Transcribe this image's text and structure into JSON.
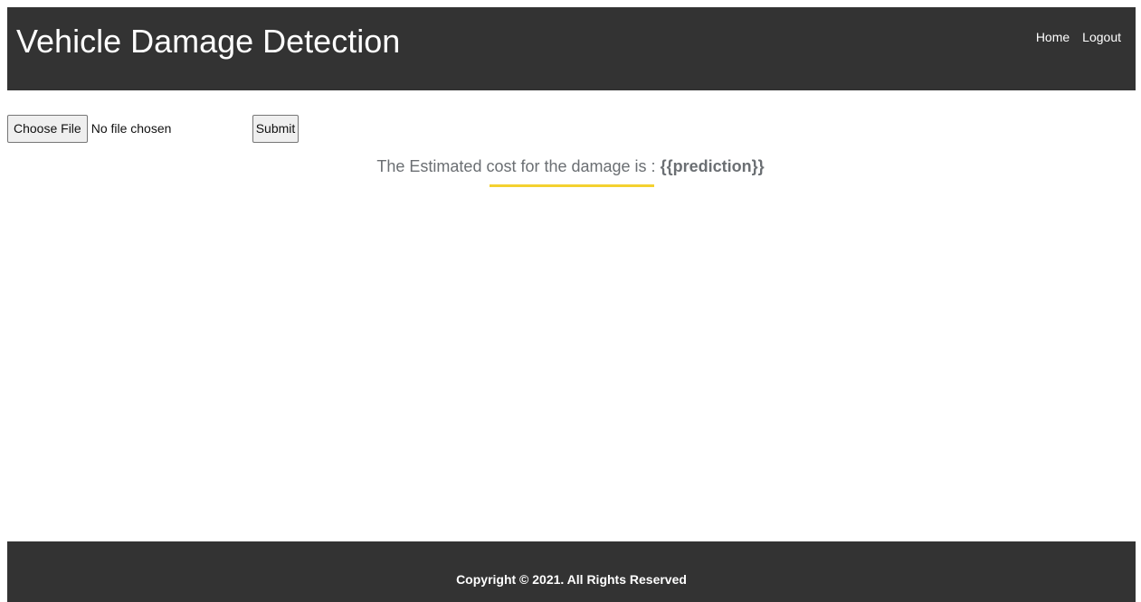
{
  "header": {
    "title": "Vehicle Damage Detection",
    "nav": {
      "home": "Home",
      "logout": "Logout"
    }
  },
  "upload": {
    "choose_file_label": "Choose File",
    "file_status": "No file chosen",
    "submit_label": "Submit"
  },
  "result": {
    "prefix": "The Estimated cost for the damage is : ",
    "prediction": "{{prediction}}"
  },
  "footer": {
    "copyright": "Copyright © 2021. All Rights Reserved"
  },
  "colors": {
    "header_background": "#333333",
    "footer_background": "#333333",
    "accent_underline": "#f4d12f",
    "result_text": "#6b6f73"
  }
}
